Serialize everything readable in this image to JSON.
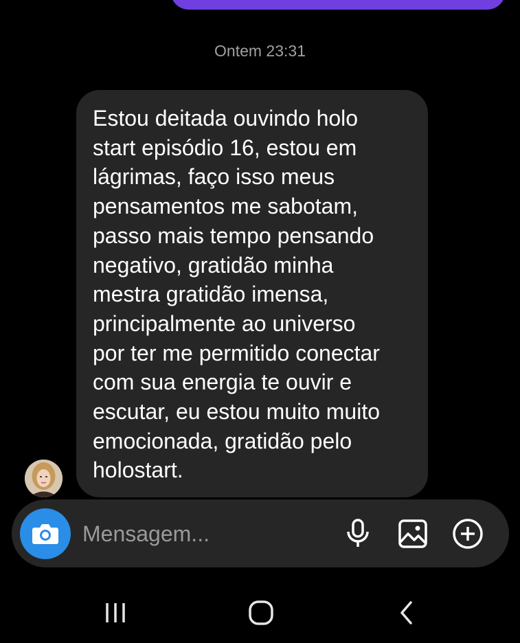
{
  "colors": {
    "background": "#000000",
    "sent_bubble": "#6f3fe0",
    "received_bubble": "#262626",
    "composer": "#262626",
    "camera_button": "#2a8de8",
    "timestamp": "#a0a0a0",
    "placeholder": "#9a9a9a"
  },
  "conversation": {
    "timestamp": "Ontem 23:31",
    "received_message": {
      "text": "Estou deitada ouvindo holo\nstart episódio 16, estou em\nlágrimas, faço isso meus\npensamentos me sabotam,\npasso mais tempo pensando\nnegativo, gratidão minha\nmestra gratidão imensa,\nprincipalmente ao universo\npor ter me permitido conectar\ncom sua energia te ouvir e\nescutar, eu estou muito muito\nemocionada, gratidão pelo\nholostart.",
      "sender_avatar_icon": "avatar"
    }
  },
  "composer": {
    "placeholder": "Mensagem...",
    "value": "",
    "icons": {
      "camera": "camera-icon",
      "mic": "microphone-icon",
      "gallery": "image-icon",
      "plus": "plus-circle-icon"
    }
  },
  "system_nav": {
    "icons": [
      "recent-apps-icon",
      "home-icon",
      "back-icon"
    ]
  }
}
